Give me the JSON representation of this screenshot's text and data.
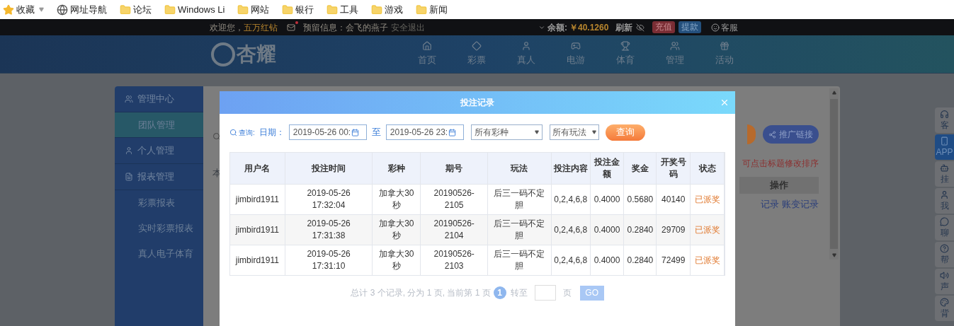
{
  "bookmarks": [
    {
      "kind": "favorites",
      "label": "收藏"
    },
    {
      "kind": "web",
      "label": "网址导航"
    },
    {
      "kind": "folder",
      "label": "论坛"
    },
    {
      "kind": "folder",
      "label": "Windows Li"
    },
    {
      "kind": "folder",
      "label": "网站"
    },
    {
      "kind": "folder",
      "label": "银行"
    },
    {
      "kind": "folder",
      "label": "工具"
    },
    {
      "kind": "folder",
      "label": "游戏"
    },
    {
      "kind": "folder",
      "label": "新闻"
    }
  ],
  "top_bar": {
    "welcome": "欢迎您，",
    "vip_level": "五万红钻",
    "mail_unread": true,
    "reserved_message": "预留信息：会飞的燕子",
    "logout": "安全退出",
    "balance_label": "余额:",
    "balance": "￥40.1260",
    "refresh": "刷新",
    "deposit": "充值",
    "withdraw": "提款",
    "service": "客服"
  },
  "nav": {
    "logo": "杏耀",
    "items": [
      {
        "kind": "home",
        "label": "首页"
      },
      {
        "kind": "lottery",
        "label": "彩票"
      },
      {
        "kind": "live",
        "label": "真人"
      },
      {
        "kind": "slots",
        "label": "电游"
      },
      {
        "kind": "sports",
        "label": "体育"
      },
      {
        "kind": "manage",
        "label": "管理"
      },
      {
        "kind": "promo",
        "label": "活动"
      }
    ]
  },
  "sidebar": [
    {
      "kind": "manage",
      "label": "管理中心",
      "children": [
        {
          "label": "团队管理",
          "selected": true
        }
      ]
    },
    {
      "kind": "person",
      "label": "个人管理"
    },
    {
      "kind": "report",
      "label": "报表管理",
      "children": [
        {
          "label": "彩票报表",
          "selected": false
        },
        {
          "label": "实时彩票报表",
          "selected": false
        },
        {
          "label": "真人电子体育",
          "selected": false
        }
      ]
    }
  ],
  "background": {
    "note_fragment": "本",
    "sort_hint": "可点击标题修改排序",
    "promo_link": "推广链接",
    "column_header": "操作",
    "links": [
      "记录",
      "账变记录"
    ]
  },
  "float_panel": [
    {
      "kind": "service",
      "label": "客"
    },
    {
      "kind": "app",
      "label": "APP"
    },
    {
      "kind": "auto",
      "label": "挂"
    },
    {
      "kind": "mine",
      "label": "我"
    },
    {
      "kind": "chat",
      "label": "聊"
    },
    {
      "kind": "help",
      "label": "帮"
    },
    {
      "kind": "sound",
      "label": "声"
    },
    {
      "kind": "theme",
      "label": "背"
    }
  ],
  "modal": {
    "title": "投注记录",
    "filter": {
      "query_label": "查询:",
      "date_label": "日期：",
      "start": "2019-05-26 00:",
      "to": "至",
      "end": "2019-05-26 23:",
      "lottery": "所有彩种",
      "play": "所有玩法",
      "button": "查询"
    },
    "table": {
      "columns": [
        "用户名",
        "投注时间",
        "彩种",
        "期号",
        "玩法",
        "投注内容",
        "投注金额",
        "奖金",
        "开奖号码",
        "状态"
      ],
      "rows": [
        [
          "jimbird1911",
          "2019-05-26 17:32:04",
          "加拿大30秒",
          "20190526-2105",
          "后三一码不定胆",
          "0,2,4,6,8",
          "0.4000",
          "0.5680",
          "40140",
          "已派奖"
        ],
        [
          "jimbird1911",
          "2019-05-26 17:31:38",
          "加拿大30秒",
          "20190526-2104",
          "后三一码不定胆",
          "0,2,4,6,8",
          "0.4000",
          "0.2840",
          "29709",
          "已派奖"
        ],
        [
          "jimbird1911",
          "2019-05-26 17:31:10",
          "加拿大30秒",
          "20190526-2103",
          "后三一码不定胆",
          "0,2,4,6,8",
          "0.4000",
          "0.2840",
          "72499",
          "已派奖"
        ]
      ]
    },
    "pagination": {
      "summary": "总计 3 个记录, 分为 1 页, 当前第 1 页",
      "pages": [
        {
          "label": "1",
          "selected": true
        }
      ],
      "goto": "转至",
      "page_unit": "页",
      "go": "GO"
    }
  }
}
